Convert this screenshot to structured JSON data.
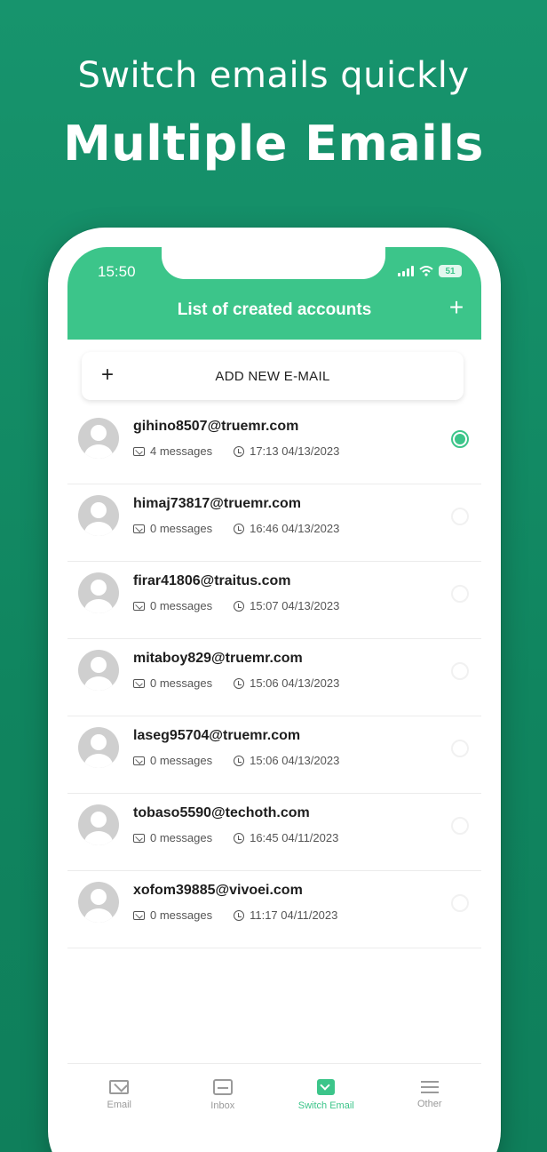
{
  "promo": {
    "subtitle": "Switch emails quickly",
    "title": "Multiple Emails"
  },
  "status_bar": {
    "time": "15:50",
    "battery": "51"
  },
  "header": {
    "title": "List of created accounts",
    "add_icon": "plus-icon"
  },
  "add_button": {
    "plus": "+",
    "label": "ADD NEW E-MAIL"
  },
  "accounts": [
    {
      "email": "gihino8507@truemr.com",
      "messages": "4 messages",
      "time": "17:13 04/13/2023",
      "selected": true
    },
    {
      "email": "himaj73817@truemr.com",
      "messages": "0 messages",
      "time": "16:46 04/13/2023",
      "selected": false
    },
    {
      "email": "firar41806@traitus.com",
      "messages": "0 messages",
      "time": "15:07 04/13/2023",
      "selected": false
    },
    {
      "email": "mitaboy829@truemr.com",
      "messages": "0 messages",
      "time": "15:06 04/13/2023",
      "selected": false
    },
    {
      "email": "laseg95704@truemr.com",
      "messages": "0 messages",
      "time": "15:06 04/13/2023",
      "selected": false
    },
    {
      "email": "tobaso5590@techoth.com",
      "messages": "0 messages",
      "time": "16:45 04/11/2023",
      "selected": false
    },
    {
      "email": "xofom39885@vivoei.com",
      "messages": "0 messages",
      "time": "11:17 04/11/2023",
      "selected": false
    }
  ],
  "bottom_nav": [
    {
      "label": "Email",
      "icon": "mail-icon",
      "active": false
    },
    {
      "label": "Inbox",
      "icon": "inbox-icon",
      "active": false
    },
    {
      "label": "Switch Email",
      "icon": "switch-email-icon",
      "active": true
    },
    {
      "label": "Other",
      "icon": "menu-icon",
      "active": false
    }
  ],
  "colors": {
    "background": "#14916a",
    "accent": "#3cc58a"
  }
}
